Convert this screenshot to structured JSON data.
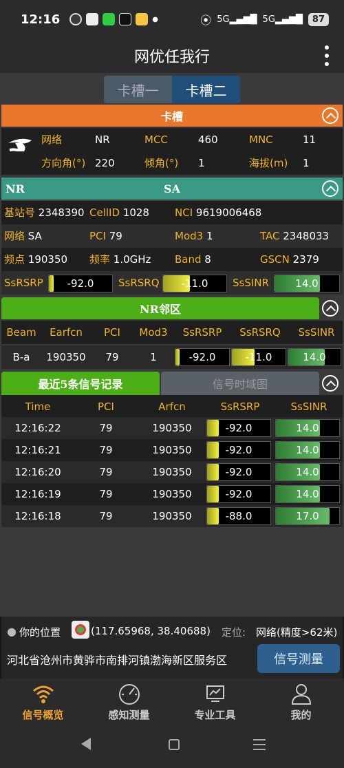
{
  "status": {
    "time": "12:16",
    "battery": "87",
    "sig1": "5G",
    "sig2": "5G"
  },
  "app": {
    "title": "网优任我行"
  },
  "slot_tabs": [
    {
      "label": "卡槽一"
    },
    {
      "label": "卡槽二"
    }
  ],
  "colors": {
    "orange": "#e8762b",
    "teal": "#3b9a86",
    "green": "#4caf18",
    "accent_yellow": "#f0b429",
    "button_blue": "#2d5f8f"
  },
  "slot_section": {
    "title": "卡槽",
    "network_label": "网络",
    "network": "NR",
    "mcc_label": "MCC",
    "mcc": "460",
    "mnc_label": "MNC",
    "mnc": "11",
    "azimuth_label": "方向角(°)",
    "azimuth": "220",
    "tilt_label": "倾角(°)",
    "tilt": "1",
    "altitude_label": "海拔(m)",
    "altitude": "1"
  },
  "nr_section": {
    "left_title": "NR",
    "center_title": "SA",
    "gnb_label": "基站号",
    "gnb": "2348390",
    "cellid_label": "CellID",
    "cellid": "1028",
    "nci_label": "NCI",
    "nci": "9619006468",
    "net_label": "网络",
    "net": "SA",
    "pci_label": "PCI",
    "pci": "79",
    "mod3_label": "Mod3",
    "mod3": "1",
    "tac_label": "TAC",
    "tac": "2348033",
    "freq_point_label": "频点",
    "freq_point": "190350",
    "freq_label": "频率",
    "freq": "1.0GHz",
    "band_label": "Band",
    "band": "8",
    "gscn_label": "GSCN",
    "gscn": "2379",
    "rsrp_label": "SsRSRP",
    "rsrp": "-92.0",
    "rsrp_level": 0.08,
    "rsrq_label": "SsRSRQ",
    "rsrq": "-11.0",
    "rsrq_level": 0.42,
    "sinr_label": "SsSINR",
    "sinr": "14.0",
    "sinr_level": 0.7
  },
  "neighbor": {
    "title": "NR邻区",
    "headers": [
      "Beam",
      "Earfcn",
      "PCI",
      "Mod3",
      "SsRSRP",
      "SsRSRQ",
      "SsSINR"
    ],
    "row": {
      "beam": "B-a",
      "earfcn": "190350",
      "pci": "79",
      "mod3": "1",
      "rsrp": "-92.0",
      "rsrp_level": 0.08,
      "rsrq": "-11.0",
      "rsrq_level": 0.42,
      "sinr": "14.0",
      "sinr_level": 0.7
    }
  },
  "records": {
    "tab_active": "最近5条信号记录",
    "tab_inactive": "信号时域图",
    "headers": [
      "Time",
      "PCI",
      "Arfcn",
      "SsRSRP",
      "SsSINR"
    ],
    "rows": [
      {
        "time": "12:16:22",
        "pci": "79",
        "arfcn": "190350",
        "rsrp": "-92.0",
        "rsrp_level": 0.18,
        "sinr": "14.0",
        "sinr_level": 0.7
      },
      {
        "time": "12:16:21",
        "pci": "79",
        "arfcn": "190350",
        "rsrp": "-92.0",
        "rsrp_level": 0.18,
        "sinr": "14.0",
        "sinr_level": 0.7
      },
      {
        "time": "12:16:20",
        "pci": "79",
        "arfcn": "190350",
        "rsrp": "-92.0",
        "rsrp_level": 0.18,
        "sinr": "14.0",
        "sinr_level": 0.7
      },
      {
        "time": "12:16:19",
        "pci": "79",
        "arfcn": "190350",
        "rsrp": "-92.0",
        "rsrp_level": 0.18,
        "sinr": "14.0",
        "sinr_level": 0.7
      },
      {
        "time": "12:16:18",
        "pci": "79",
        "arfcn": "190350",
        "rsrp": "-88.0",
        "rsrp_level": 0.18,
        "sinr": "17.0",
        "sinr_level": 0.85
      }
    ]
  },
  "location": {
    "label": "你的位置",
    "coords": "(117.65968, 38.40688)",
    "mode_label": "定位:",
    "mode": "网络(精度>62米)",
    "address": "河北省沧州市黄骅市南排河镇渤海新区服务区",
    "button": "信号测量"
  },
  "nav": [
    {
      "label": "信号概览",
      "icon": "wifi-icon",
      "active": true
    },
    {
      "label": "感知测量",
      "icon": "gauge-icon",
      "active": false
    },
    {
      "label": "专业工具",
      "icon": "toolbox-icon",
      "active": false
    },
    {
      "label": "我的",
      "icon": "person-icon",
      "active": false
    }
  ]
}
